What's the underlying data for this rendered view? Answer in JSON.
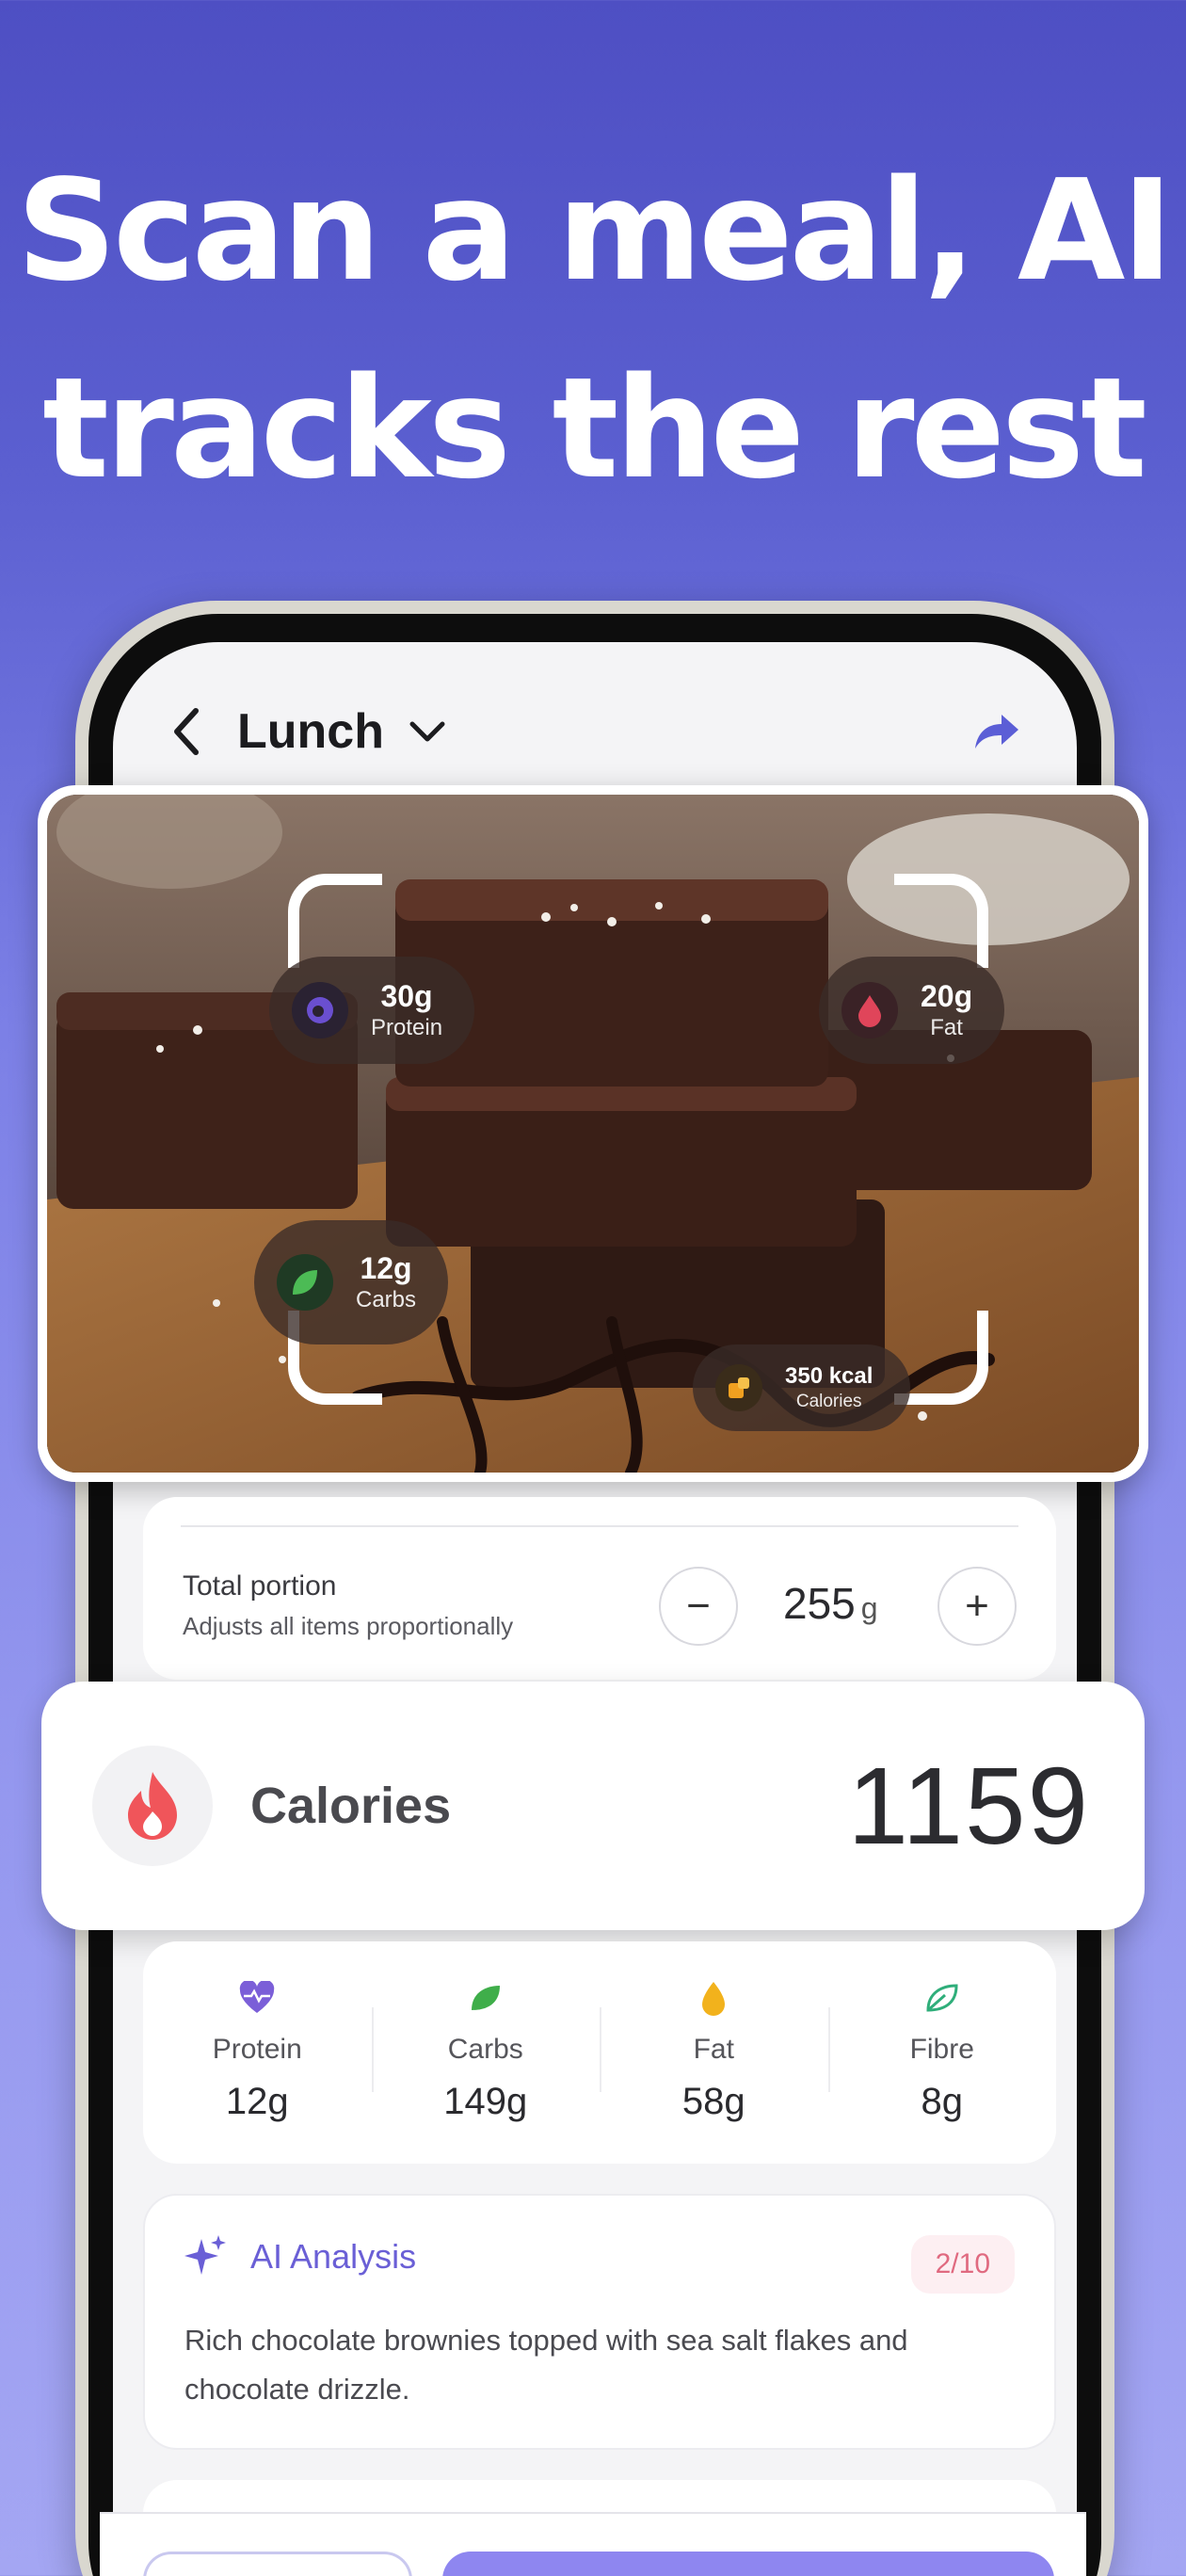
{
  "headline": {
    "line1": "Scan a meal, AI",
    "line2": "tracks the rest"
  },
  "nav": {
    "title": "Lunch",
    "back_icon": "chevron-left-icon",
    "dropdown_icon": "chevron-down-icon",
    "share_icon": "share-arrow-icon",
    "accent": "#5b5ed6"
  },
  "photo_overlay": {
    "protein": {
      "value": "30g",
      "label": "Protein",
      "icon": "protein-icon",
      "color": "#6a4fd0"
    },
    "fat": {
      "value": "20g",
      "label": "Fat",
      "icon": "drop-icon",
      "color": "#e0455a"
    },
    "carbs": {
      "value": "12g",
      "label": "Carbs",
      "icon": "leaf-icon",
      "color": "#3f9a45"
    },
    "calories": {
      "value": "350 kcal",
      "label": "Calories",
      "icon": "calories-icon",
      "color": "#f0a020"
    }
  },
  "portion": {
    "title": "Total portion",
    "subtitle": "Adjusts all items proportionally",
    "value": "255",
    "unit": "g",
    "minus": "−",
    "plus": "+"
  },
  "calories": {
    "label": "Calories",
    "value": "1159",
    "icon": "flame-icon",
    "color": "#f0555a"
  },
  "macros": [
    {
      "label": "Protein",
      "value": "12g",
      "icon": "heart-pulse-icon",
      "color": "#7b5fd8"
    },
    {
      "label": "Carbs",
      "value": "149g",
      "icon": "leaf-icon",
      "color": "#3fae4a"
    },
    {
      "label": "Fat",
      "value": "58g",
      "icon": "drop-icon",
      "color": "#f2b21c"
    },
    {
      "label": "Fibre",
      "value": "8g",
      "icon": "leaf-outline-icon",
      "color": "#2fae7a"
    }
  ],
  "ai": {
    "title": "AI Analysis",
    "score": "2/10",
    "text": "Rich chocolate brownies topped with sea salt flakes and chocolate drizzle.",
    "icon": "sparkle-icon"
  }
}
